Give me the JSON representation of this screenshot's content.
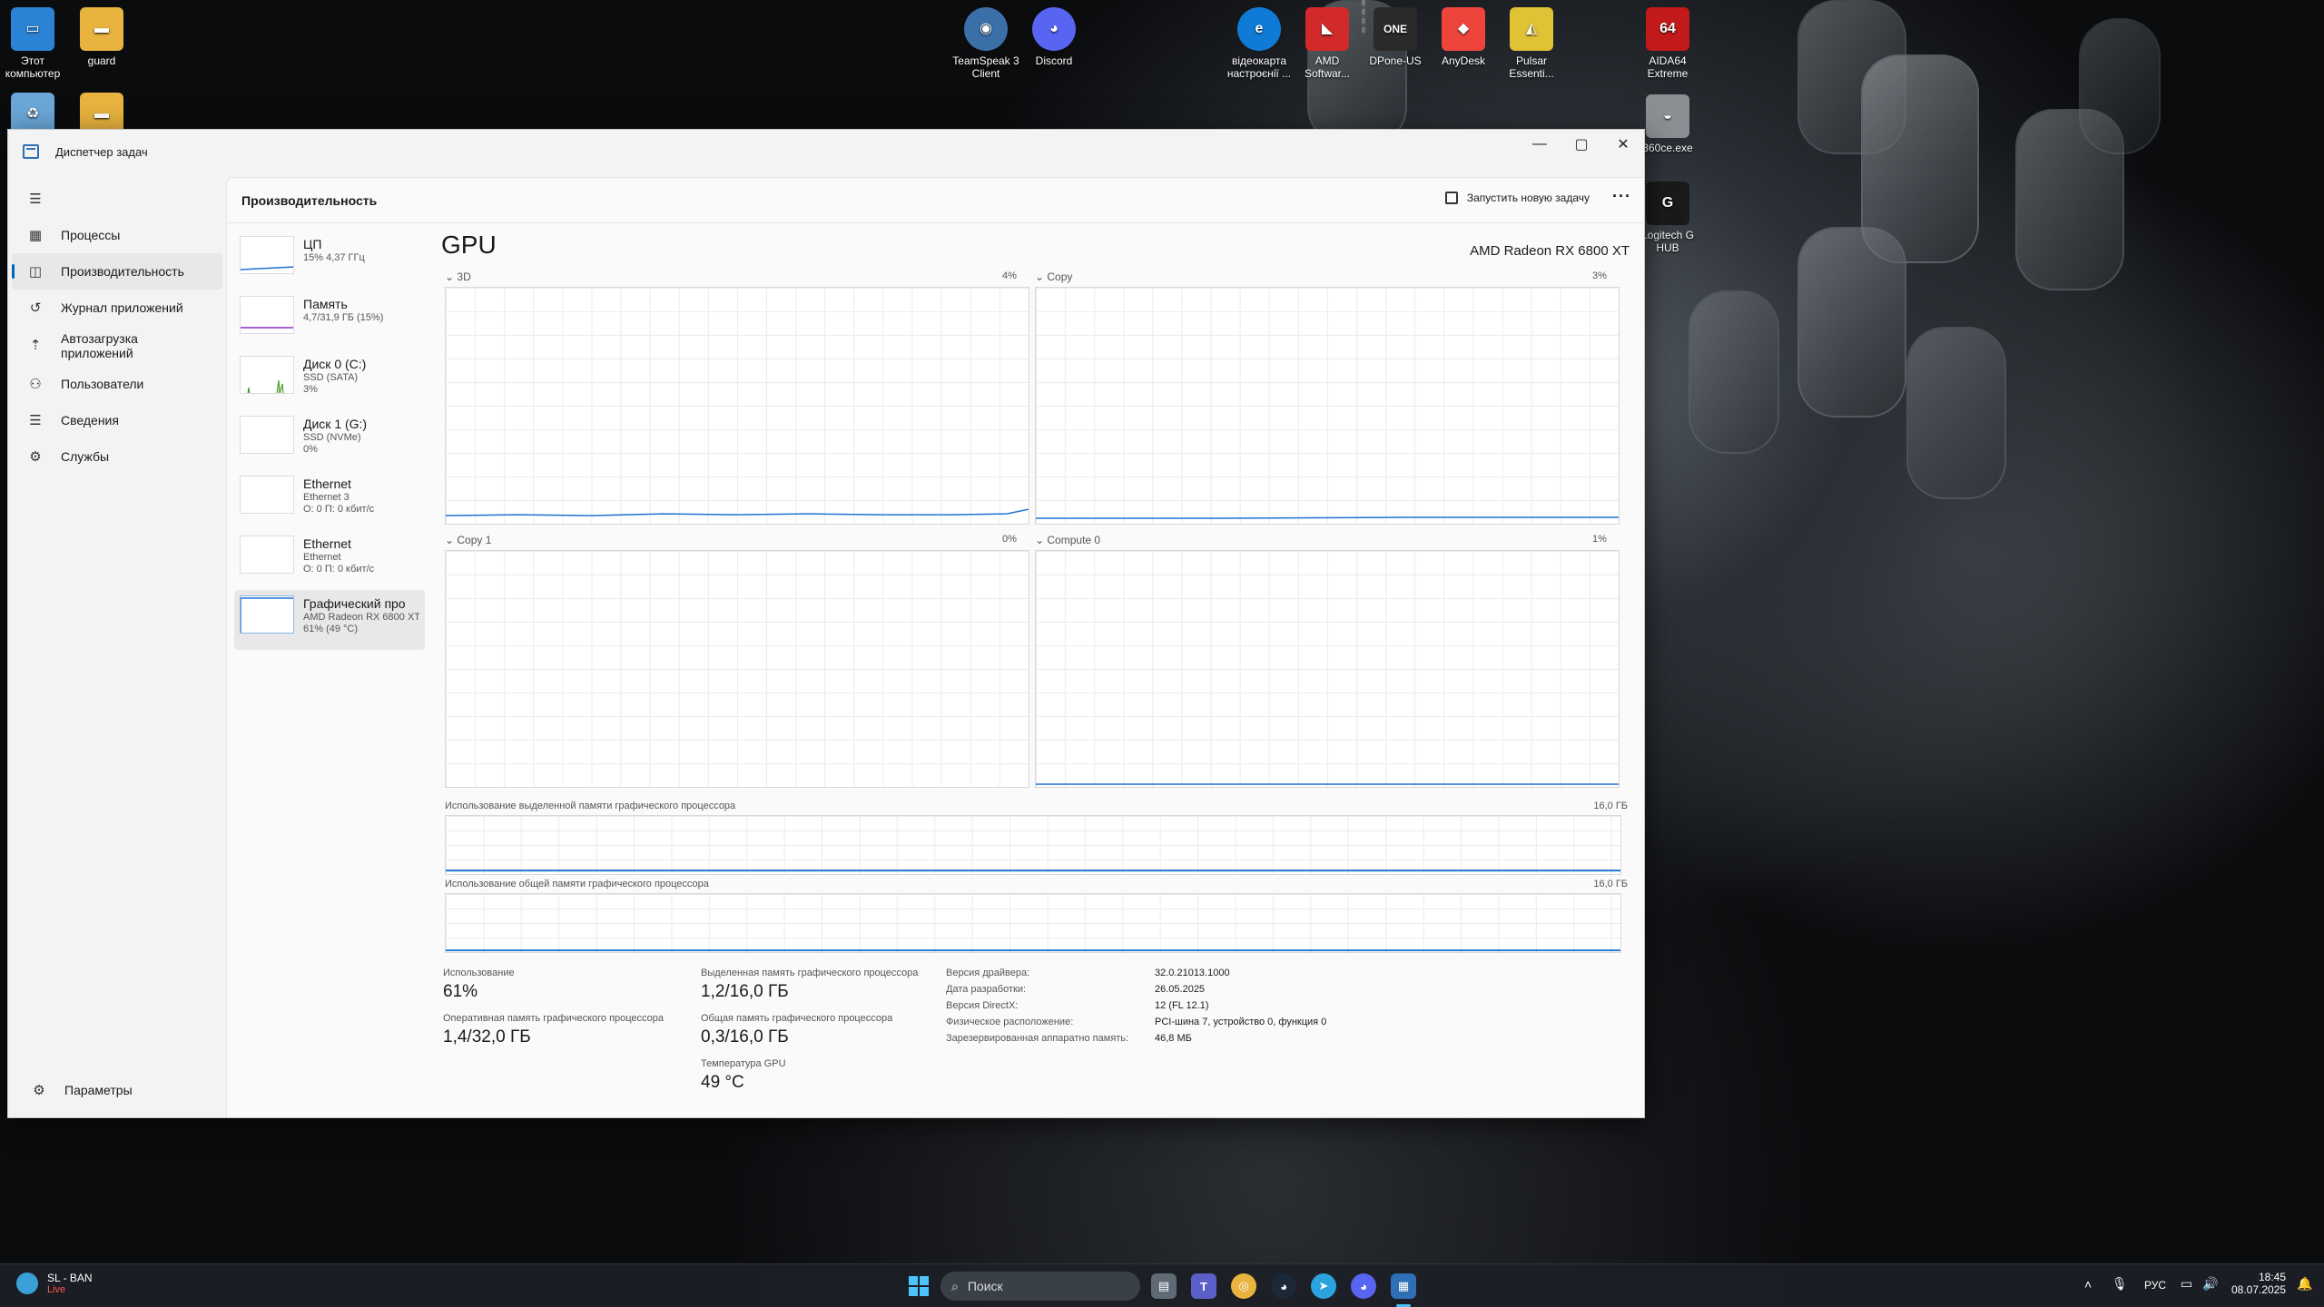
{
  "desktop": {
    "icons": [
      {
        "label": "Этот компьютер",
        "color": "#2b83d6",
        "glyph": "▭"
      },
      {
        "label": "guard",
        "color": "#e8b33e",
        "glyph": "▬"
      },
      {
        "label": "TeamSpeak 3 Client",
        "color": "#3b6fa8",
        "glyph": "◉"
      },
      {
        "label": "Discord",
        "color": "#5865f2",
        "glyph": "◕"
      },
      {
        "label": "відеокарта настроєнії ...",
        "color": "#0f7bd6",
        "glyph": "e"
      },
      {
        "label": "AMD Softwar...",
        "color": "#d22a2a",
        "glyph": "◣"
      },
      {
        "label": "DPone-US",
        "color": "#2a2a2a",
        "glyph": "ONE"
      },
      {
        "label": "AnyDesk",
        "color": "#ef443b",
        "glyph": "◆"
      },
      {
        "label": "Pulsar Essenti...",
        "color": "#e0c235",
        "glyph": "◭"
      },
      {
        "label": "AIDA64 Extreme",
        "color": "#c21a1a",
        "glyph": "64"
      },
      {
        "label": "360ce.exe",
        "color": "#8a8f94",
        "glyph": "◒"
      },
      {
        "label": "Logitech G HUB",
        "color": "#1a1a1a",
        "glyph": "G"
      }
    ]
  },
  "window": {
    "title": "Диспетчер задач",
    "min": "—",
    "max": "▢",
    "close": "✕"
  },
  "sidebar": {
    "menu": "☰",
    "items": [
      {
        "label": "Процессы",
        "icon": "▦"
      },
      {
        "label": "Производительность",
        "icon": "◫"
      },
      {
        "label": "Журнал приложений",
        "icon": "↺"
      },
      {
        "label": "Автозагрузка приложений",
        "icon": "⇡"
      },
      {
        "label": "Пользователи",
        "icon": "⚇"
      },
      {
        "label": "Сведения",
        "icon": "☰"
      },
      {
        "label": "Службы",
        "icon": "⚙"
      }
    ],
    "settings": {
      "label": "Параметры",
      "icon": "⚙"
    }
  },
  "main": {
    "heading": "Производительность",
    "run_task": "Запустить новую задачу",
    "more": "···"
  },
  "resources": [
    {
      "name": "ЦП",
      "sub1": "15% 4,37 ГГц",
      "sub2": "",
      "sub3": "",
      "color": "#1f73d1"
    },
    {
      "name": "Память",
      "sub1": "4,7/31,9 ГБ (15%)",
      "sub2": "",
      "sub3": "",
      "color": "#8b2fc9"
    },
    {
      "name": "Диск 0 (C:)",
      "sub1": "SSD (SATA)",
      "sub2": "3%",
      "sub3": "",
      "color": "#4c9a2a"
    },
    {
      "name": "Диск 1 (G:)",
      "sub1": "SSD (NVMe)",
      "sub2": "0%",
      "sub3": "",
      "color": "#4c9a2a"
    },
    {
      "name": "Ethernet",
      "sub1": "Ethernet 3",
      "sub2": "О: 0 П: 0 кбит/с",
      "sub3": "",
      "color": "#a0522d"
    },
    {
      "name": "Ethernet",
      "sub1": "Ethernet",
      "sub2": "О: 0 П: 0 кбит/с",
      "sub3": "",
      "color": "#a0522d"
    },
    {
      "name": "Графический про",
      "sub1": "AMD Radeon RX 6800 XT",
      "sub2": "61% (49 °C)",
      "sub3": "",
      "color": "#1f73d1"
    }
  ],
  "gpu": {
    "title": "GPU",
    "model": "AMD Radeon RX 6800 XT",
    "engines": [
      {
        "name": "3D",
        "pct": "4%",
        "level": 0.04
      },
      {
        "name": "Copy",
        "pct": "3%",
        "level": 0.02
      },
      {
        "name": "Copy 1",
        "pct": "0%",
        "level": 0.0
      },
      {
        "name": "Compute 0",
        "pct": "1%",
        "level": 0.01
      }
    ],
    "dedicated_label": "Использование выделенной памяти графического процессора",
    "dedicated_max": "16,0 ГБ",
    "shared_label": "Использование общей памяти графического процессора",
    "shared_max": "16,0 ГБ",
    "stats": {
      "usage_label": "Использование",
      "usage_value": "61%",
      "dedicated_mem_label": "Выделенная память графического процессора",
      "dedicated_mem_value": "1,2/16,0 ГБ",
      "ram_label": "Оперативная память графического процессора",
      "ram_value": "1,4/32,0 ГБ",
      "shared_mem_label": "Общая память графического процессора",
      "shared_mem_value": "0,3/16,0 ГБ",
      "temp_label": "Температура GPU",
      "temp_value": "49 °C"
    },
    "info": [
      {
        "label": "Версия драйвера:",
        "value": "32.0.21013.1000"
      },
      {
        "label": "Дата разработки:",
        "value": "26.05.2025"
      },
      {
        "label": "Версия DirectX:",
        "value": "12 (FL 12.1)"
      },
      {
        "label": "Физическое расположение:",
        "value": "PCI-шина 7, устройство 0, функция 0"
      },
      {
        "label": "Зарезервированная аппаратно память:",
        "value": "46,8 МБ"
      }
    ]
  },
  "taskbar": {
    "weather_title": "SL - BAN",
    "weather_sub": "Live",
    "search": "Поиск",
    "lang": "РУС",
    "time": "18:45",
    "date": "08.07.2025"
  }
}
